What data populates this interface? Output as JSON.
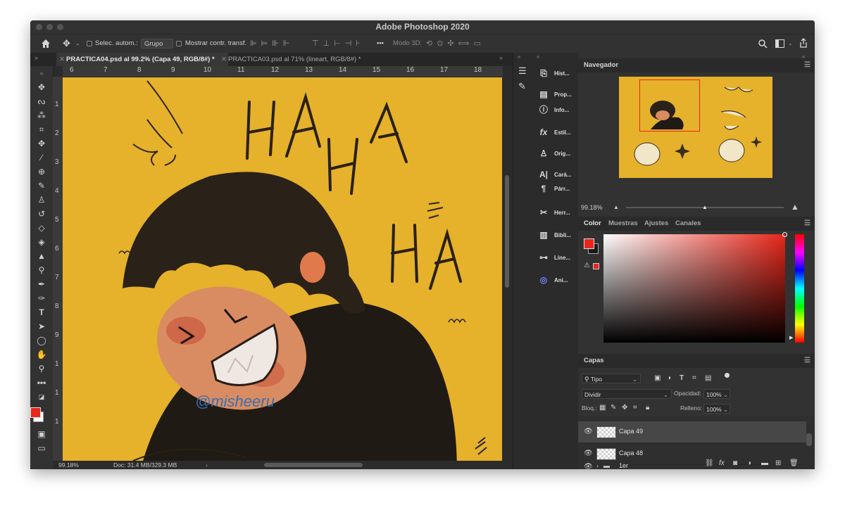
{
  "app": {
    "title": "Adobe Photoshop 2020"
  },
  "options_bar": {
    "auto_select_label": "Selec. autom.:",
    "auto_select_value": "Grupo",
    "show_transform_label": "Mostrar contr. transf.",
    "more_label": "•••",
    "mode3d_label": "Modo 3D:"
  },
  "tabs": [
    {
      "label": "PRACTICA04.psd al 99.2% (Capa 49, RGB/8#) *",
      "active": true
    },
    {
      "label": "PRACTICA03.psd al 71% (lineart, RGB/8#) *",
      "active": false
    }
  ],
  "ruler": {
    "h_ticks": [
      "6",
      "7",
      "8",
      "9",
      "10",
      "11",
      "12",
      "13",
      "14",
      "15",
      "16",
      "17",
      "18"
    ],
    "v_ticks": [
      "1",
      "2",
      "3",
      "4",
      "5",
      "6",
      "7",
      "8",
      "9",
      "1",
      "1",
      "1"
    ]
  },
  "canvas": {
    "words": [
      "HA",
      "HA",
      "HA"
    ],
    "signature": "@misheeru"
  },
  "status": {
    "zoom": "99.18%",
    "doc": "Doc: 31.4 MB/329.3 MB"
  },
  "dock_panels": [
    {
      "icon": "history-icon",
      "label": "Hist..."
    },
    {
      "icon": "properties-icon",
      "label": "Prop..."
    },
    {
      "icon": "info-icon",
      "label": "Info..."
    },
    {
      "icon": "styles-icon",
      "label": "Estil..."
    },
    {
      "icon": "clone-source-icon",
      "label": "Orig..."
    },
    {
      "icon": "character-icon",
      "label": "Cará..."
    },
    {
      "icon": "paragraph-icon",
      "label": "Párr..."
    },
    {
      "icon": "tool-presets-icon",
      "label": "Herr..."
    },
    {
      "icon": "libraries-icon",
      "label": "Bibli..."
    },
    {
      "icon": "timeline-icon",
      "label": "Líne..."
    },
    {
      "icon": "animation-icon",
      "label": "Ani..."
    }
  ],
  "navigator": {
    "title": "Navegador",
    "zoom": "99.18%"
  },
  "color_panel": {
    "tabs": [
      "Color",
      "Muestras",
      "Ajustes",
      "Canales"
    ],
    "foreground": "#e8261a",
    "background": "#ffffff"
  },
  "layers_panel": {
    "title": "Capas",
    "filter": "Tipo",
    "blend_mode": "Dividir",
    "opacity_label": "Opacidad:",
    "opacity_value": "100%",
    "lock_label": "Bloq.:",
    "fill_label": "Relleno:",
    "fill_value": "100%",
    "layers": [
      {
        "name": "Capa 49",
        "selected": true
      },
      {
        "name": "Capa 48",
        "selected": false
      },
      {
        "name": "1er",
        "selected": false,
        "group": true
      }
    ]
  }
}
